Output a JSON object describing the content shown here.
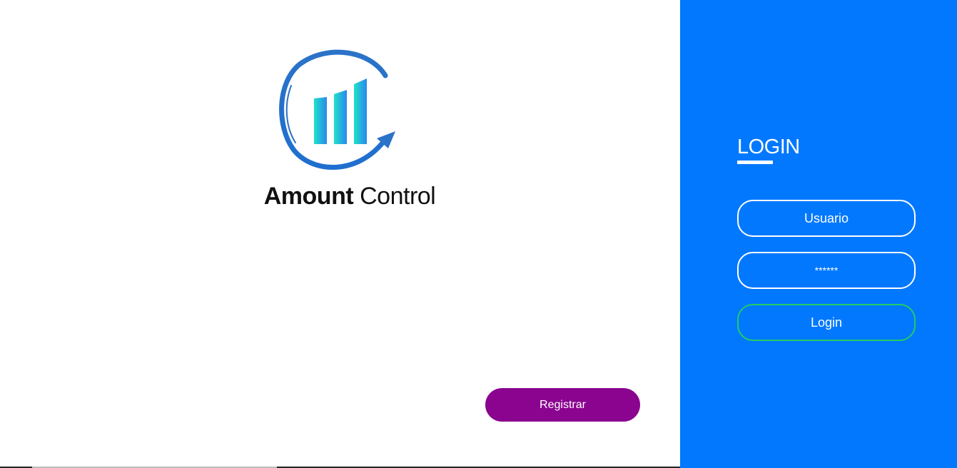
{
  "brand": {
    "name_bold": "Amount",
    "name_light": "Control",
    "logo_icon": "growth-chart-logo-icon"
  },
  "left": {
    "register_label": "Registrar"
  },
  "login": {
    "title": "LOGIN",
    "username_placeholder": "Usuario",
    "password_value": "******",
    "submit_label": "Login"
  },
  "colors": {
    "panel_blue": "#0178fe",
    "register_purple": "#8a048f",
    "login_border_green": "#22cc66",
    "logo_blue": "#2576c9",
    "logo_bar_gradient": [
      "#1ee3c9",
      "#2b87ee"
    ]
  }
}
